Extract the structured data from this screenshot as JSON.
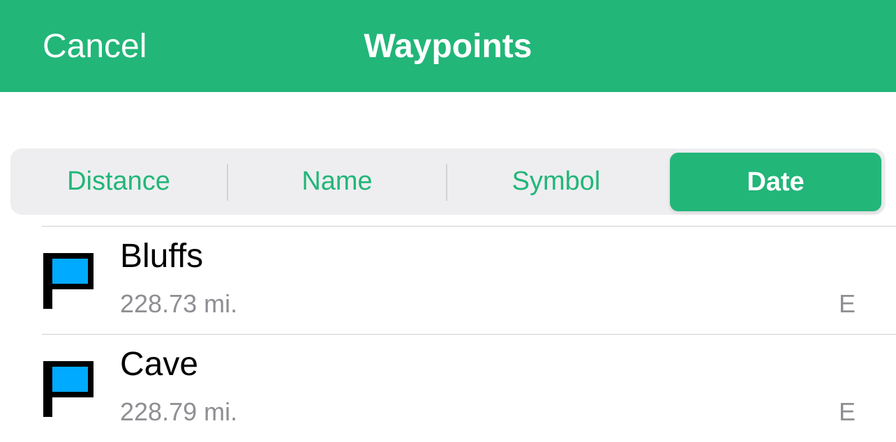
{
  "navbar": {
    "cancel_label": "Cancel",
    "title": "Waypoints",
    "color": "#22b679"
  },
  "sort": {
    "segments": [
      "Distance",
      "Name",
      "Symbol",
      "Date"
    ],
    "selected": "Date"
  },
  "waypoints": [
    {
      "name": "Bluffs",
      "distance": "228.73 mi.",
      "direction": "E",
      "icon": "flag-icon"
    },
    {
      "name": "Cave",
      "distance": "228.79 mi.",
      "direction": "E",
      "icon": "flag-icon"
    }
  ],
  "colors": {
    "accent": "#22b679",
    "flag_fill": "#00aaff",
    "flag_outline": "#000000"
  }
}
